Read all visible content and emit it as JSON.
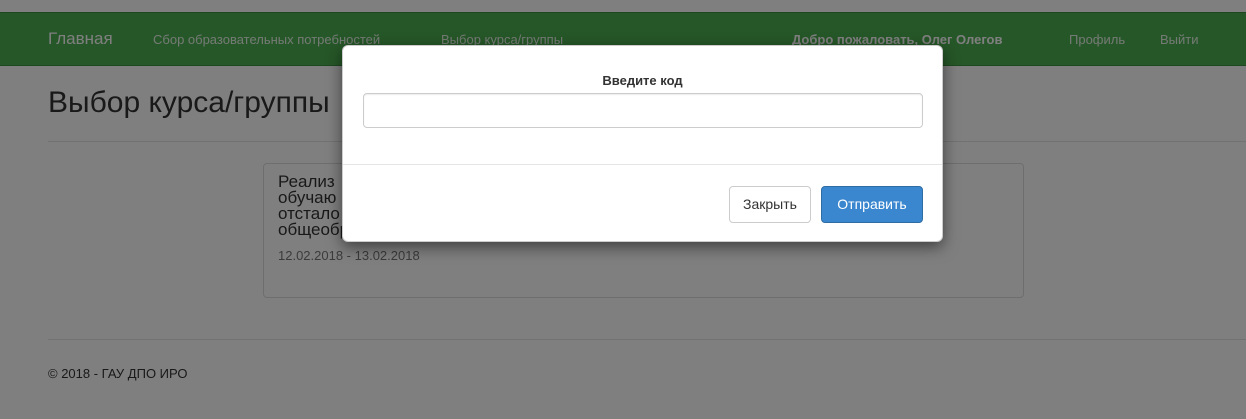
{
  "navbar": {
    "brand": "Главная",
    "links": [
      "Сбор образовательных потребностей",
      "Выбор курса/группы"
    ],
    "welcome": "Добро пожаловать, Олег Олегов",
    "profile": "Профиль",
    "logout": "Выйти"
  },
  "page": {
    "title": "Выбор курса/группы"
  },
  "course": {
    "title": "Реализация адаптированных программ для обучающихся с умственной отсталостью в условиях общеобразовательной организации",
    "visible_lines": [
      "Реализ",
      "обучаю",
      "отстало",
      "общеобразовательной организации"
    ],
    "dates": "12.02.2018 - 13.02.2018"
  },
  "footer": {
    "text": "© 2018 - ГАУ ДПО ИРО"
  },
  "modal": {
    "title": "Введите код",
    "input_value": "",
    "close_label": "Закрыть",
    "send_label": "Отправить"
  },
  "colors": {
    "navbar": "#4caf50",
    "primary_button": "#3a87cf"
  }
}
